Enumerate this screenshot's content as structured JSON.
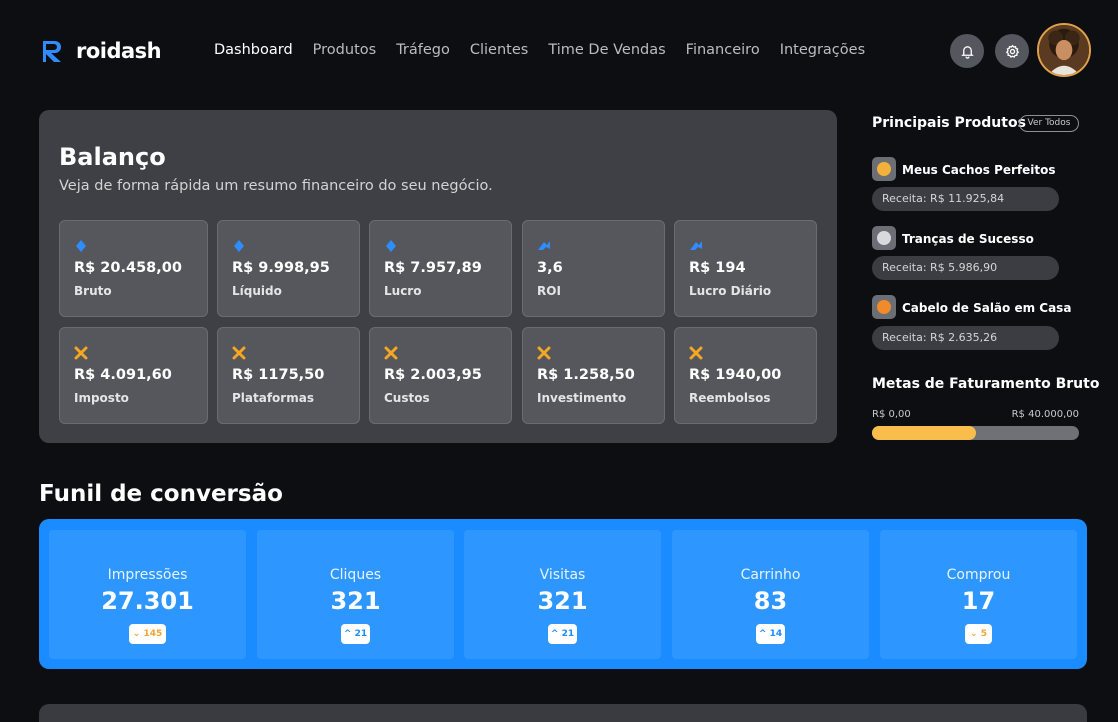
{
  "brand": {
    "name": "roidash",
    "color": "#2f8cff"
  },
  "nav": {
    "items": [
      "Dashboard",
      "Produtos",
      "Tráfego",
      "Clientes",
      "Time De Vendas",
      "Financeiro",
      "Integrações"
    ],
    "active": "Dashboard"
  },
  "header_icons": [
    "bell-icon",
    "gear-icon"
  ],
  "balance": {
    "title": "Balanço",
    "subtitle": "Veja de forma rápida um resumo financeiro do seu negócio.",
    "stats": [
      {
        "value": "R$ 20.458,00",
        "label": "Bruto",
        "icon": "blue-diamond-icon"
      },
      {
        "value": "R$ 9.998,95",
        "label": "Líquido",
        "icon": "blue-diamond-icon"
      },
      {
        "value": "R$ 7.957,89",
        "label": "Lucro",
        "icon": "blue-diamond-icon"
      },
      {
        "value": "3,6",
        "label": "ROI",
        "icon": "blue-arrow-icon"
      },
      {
        "value": "R$ 194",
        "label": "Lucro Diário",
        "icon": "blue-arrow-icon"
      },
      {
        "value": "R$ 4.091,60",
        "label": "Imposto",
        "icon": "orange-x-icon"
      },
      {
        "value": "R$ 1175,50",
        "label": "Plataformas",
        "icon": "orange-x-icon"
      },
      {
        "value": "R$ 2.003,95",
        "label": "Custos",
        "icon": "orange-x-icon"
      },
      {
        "value": "R$ 1.258,50",
        "label": "Investimento",
        "icon": "orange-x-icon"
      },
      {
        "value": "R$ 1940,00",
        "label": "Reembolsos",
        "icon": "orange-x-icon"
      }
    ]
  },
  "top_products": {
    "title": "Principais Produtos",
    "see_all": "Ver Todos",
    "items": [
      {
        "name": "Meus Cachos Perfeitos",
        "revenue": "Receita: R$ 11.925,84",
        "thumb_color": "#f3b13c"
      },
      {
        "name": "Tranças de Sucesso",
        "revenue": "Receita: R$ 5.986,90",
        "thumb_color": "#d7d9dd"
      },
      {
        "name": "Cabelo de Salão em Casa",
        "revenue": "Receita: R$ 2.635,26",
        "thumb_color": "#f08a2b"
      }
    ]
  },
  "goal": {
    "title": "Metas de Faturamento Bruto",
    "min": "R$ 0,00",
    "max": "R$ 40.000,00",
    "progress": 0.5
  },
  "funnel": {
    "title": "Funil de conversão",
    "stages": [
      {
        "label": "Impressões",
        "value": "27.301",
        "badge": "145",
        "direction": "down"
      },
      {
        "label": "Cliques",
        "value": "321",
        "badge": "21",
        "direction": "up"
      },
      {
        "label": "Visitas",
        "value": "321",
        "badge": "21",
        "direction": "up"
      },
      {
        "label": "Carrinho",
        "value": "83",
        "badge": "14",
        "direction": "up"
      },
      {
        "label": "Comprou",
        "value": "17",
        "badge": "5",
        "direction": "down"
      }
    ]
  }
}
